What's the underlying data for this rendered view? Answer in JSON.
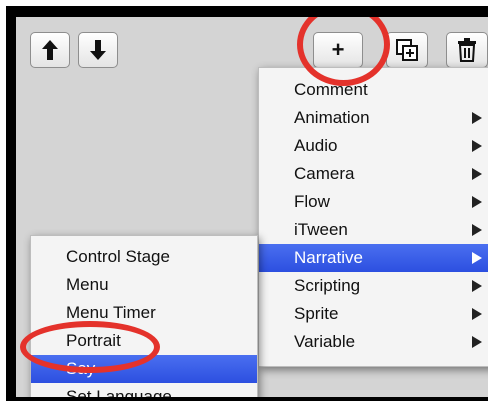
{
  "toolbar": {
    "up_icon": "arrow-up-icon",
    "down_icon": "arrow-down-icon",
    "add_label": "+",
    "duplicate_icon": "duplicate-icon",
    "delete_icon": "trash-icon"
  },
  "add_menu": {
    "items": [
      {
        "label": "Comment",
        "submenu": false
      },
      {
        "label": "Animation",
        "submenu": true
      },
      {
        "label": "Audio",
        "submenu": true
      },
      {
        "label": "Camera",
        "submenu": true
      },
      {
        "label": "Flow",
        "submenu": true
      },
      {
        "label": "iTween",
        "submenu": true
      },
      {
        "label": "Narrative",
        "submenu": true,
        "selected": true
      },
      {
        "label": "Scripting",
        "submenu": true
      },
      {
        "label": "Sprite",
        "submenu": true
      },
      {
        "label": "Variable",
        "submenu": true
      }
    ]
  },
  "narrative_menu": {
    "items": [
      {
        "label": "Control Stage"
      },
      {
        "label": "Menu"
      },
      {
        "label": "Menu Timer"
      },
      {
        "label": "Portrait"
      },
      {
        "label": "Say",
        "selected": true
      },
      {
        "label": "Set Language"
      }
    ]
  },
  "colors": {
    "highlight": "#2c4fe0",
    "annotation": "#e4322b",
    "panel": "#d4d4d4"
  }
}
